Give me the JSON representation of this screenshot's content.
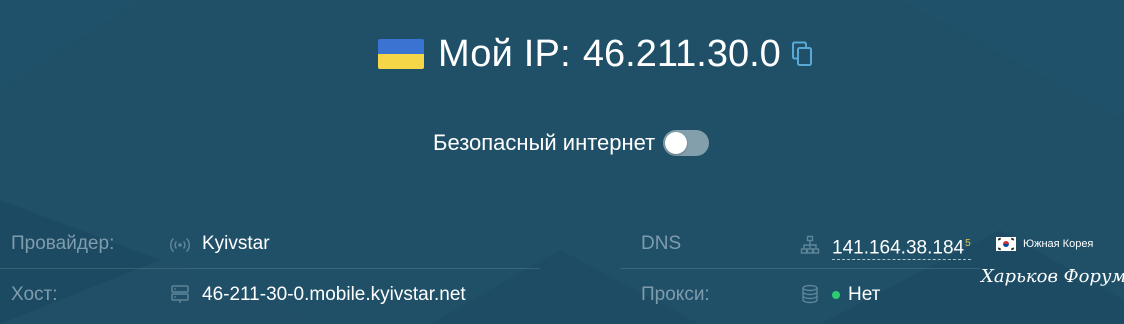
{
  "header": {
    "flag": "ukraine-flag",
    "label": "Мой IP:",
    "ip": "46.211.30.0",
    "copy_icon": "copy-icon"
  },
  "safe_internet": {
    "label": "Безопасный интернет",
    "enabled": false
  },
  "info": {
    "provider": {
      "label": "Провайдер:",
      "icon": "signal-icon",
      "value": "Kyivstar"
    },
    "host": {
      "label": "Хост:",
      "icon": "server-icon",
      "value": "46-211-30-0.mobile.kyivstar.net"
    },
    "dns": {
      "label": "DNS",
      "icon": "network-icon",
      "value": "141.164.38.184",
      "count": "5",
      "country_flag": "south-korea-flag",
      "country": "Южная Корея"
    },
    "proxy": {
      "label": "Прокси:",
      "icon": "database-icon",
      "status_color": "#2ecc71",
      "value": "Нет"
    }
  },
  "watermark": "Харьков Форум",
  "colors": {
    "background": "#1f5068",
    "label": "#7f9cad",
    "accent_blue": "#3a73d1",
    "accent_yellow": "#f5d649",
    "status_green": "#2ecc71"
  }
}
